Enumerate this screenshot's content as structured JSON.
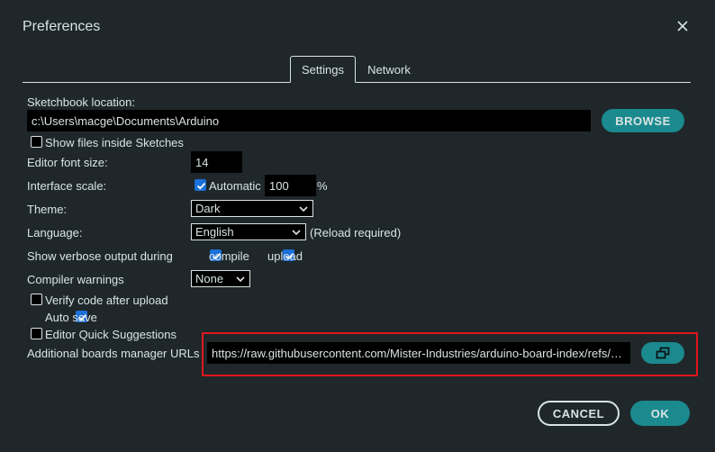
{
  "dialog": {
    "title": "Preferences"
  },
  "tabs": [
    {
      "label": "Settings",
      "active": true
    },
    {
      "label": "Network",
      "active": false
    }
  ],
  "sketchbook": {
    "label": "Sketchbook location:",
    "path": "c:\\Users\\macge\\Documents\\Arduino",
    "browse_label": "BROWSE"
  },
  "show_files": {
    "label": "Show files inside Sketches",
    "checked": false
  },
  "font_size": {
    "label": "Editor font size:",
    "value": "14"
  },
  "interface_scale": {
    "label": "Interface scale:",
    "automatic_label": "Automatic",
    "automatic_checked": true,
    "value": "100",
    "unit": "%"
  },
  "theme": {
    "label": "Theme:",
    "selected": "Dark"
  },
  "language": {
    "label": "Language:",
    "selected": "English",
    "note": "(Reload required)"
  },
  "verbose": {
    "label": "Show verbose output during",
    "compile_label": "compile",
    "compile_checked": true,
    "upload_label": "upload",
    "upload_checked": true
  },
  "compiler_warnings": {
    "label": "Compiler warnings",
    "selected": "None"
  },
  "verify_after_upload": {
    "label": "Verify code after upload",
    "checked": false
  },
  "auto_save": {
    "label": "Auto save",
    "checked": true
  },
  "quick_suggestions": {
    "label": "Editor Quick Suggestions",
    "checked": false
  },
  "boards_urls": {
    "label": "Additional boards manager URLs",
    "value": "https://raw.githubusercontent.com/Mister-Industries/arduino-board-index/refs/…"
  },
  "footer": {
    "cancel_label": "CANCEL",
    "ok_label": "OK"
  },
  "colors": {
    "background": "#1f272a",
    "accent_teal": "#1b8a8f",
    "checkbox_blue": "#1b6fd8",
    "highlight_red": "#e0161e"
  }
}
